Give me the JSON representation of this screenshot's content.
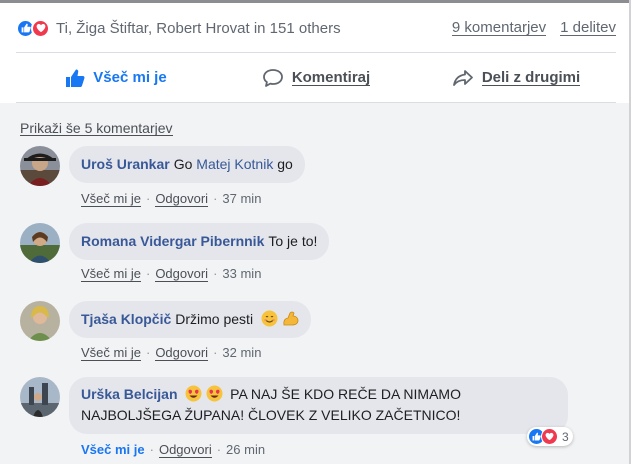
{
  "summary": {
    "names": "Ti, Žiga Štiftar, Robert Hrovat in 151 others",
    "comments_count": "9 komentarjev",
    "shares_count": "1 delitev",
    "reactions": [
      "like-icon",
      "love-icon"
    ]
  },
  "actions": {
    "like": "Všeč mi je",
    "comment": "Komentiraj",
    "share": "Deli z drugimi"
  },
  "more_comments": "Prikaži še 5 komentarjev",
  "comments": [
    {
      "author": "Uroš Urankar",
      "text_before": "Go ",
      "mention": "Matej Kotnik",
      "text_after": " go",
      "like_label": "Všeč mi je",
      "reply_label": "Odgovori",
      "time": "37 min"
    },
    {
      "author": "Romana Vidergar Pibernnik",
      "text": "To je to!",
      "like_label": "Všeč mi je",
      "reply_label": "Odgovori",
      "time": "33 min"
    },
    {
      "author": "Tjaša Klopčič",
      "text": "Držimo pesti",
      "emojis": [
        "smiling-face-icon",
        "flexed-biceps-icon"
      ],
      "like_label": "Všeč mi je",
      "reply_label": "Odgovori",
      "time": "32 min"
    },
    {
      "author": "Urška Belcijan",
      "emojis": [
        "heart-eyes-icon",
        "heart-eyes-icon"
      ],
      "text_line1": "PA NAJ ŠE KDO REČE DA NIMAMO",
      "text_line2": "NAJBOLJŠEGA ŽUPANA! ČLOVEK Z VELIKO ZAČETNICO!",
      "like_label": "Všeč mi je",
      "reply_label": "Odgovori",
      "time": "26 min",
      "reaction_count": "3",
      "liked_by_you": true
    }
  ],
  "colors": {
    "facebook_blue": "#1877f2",
    "link_blue": "#385898",
    "love_red": "#f0384f",
    "bubble_gray": "#e4e6eb"
  }
}
